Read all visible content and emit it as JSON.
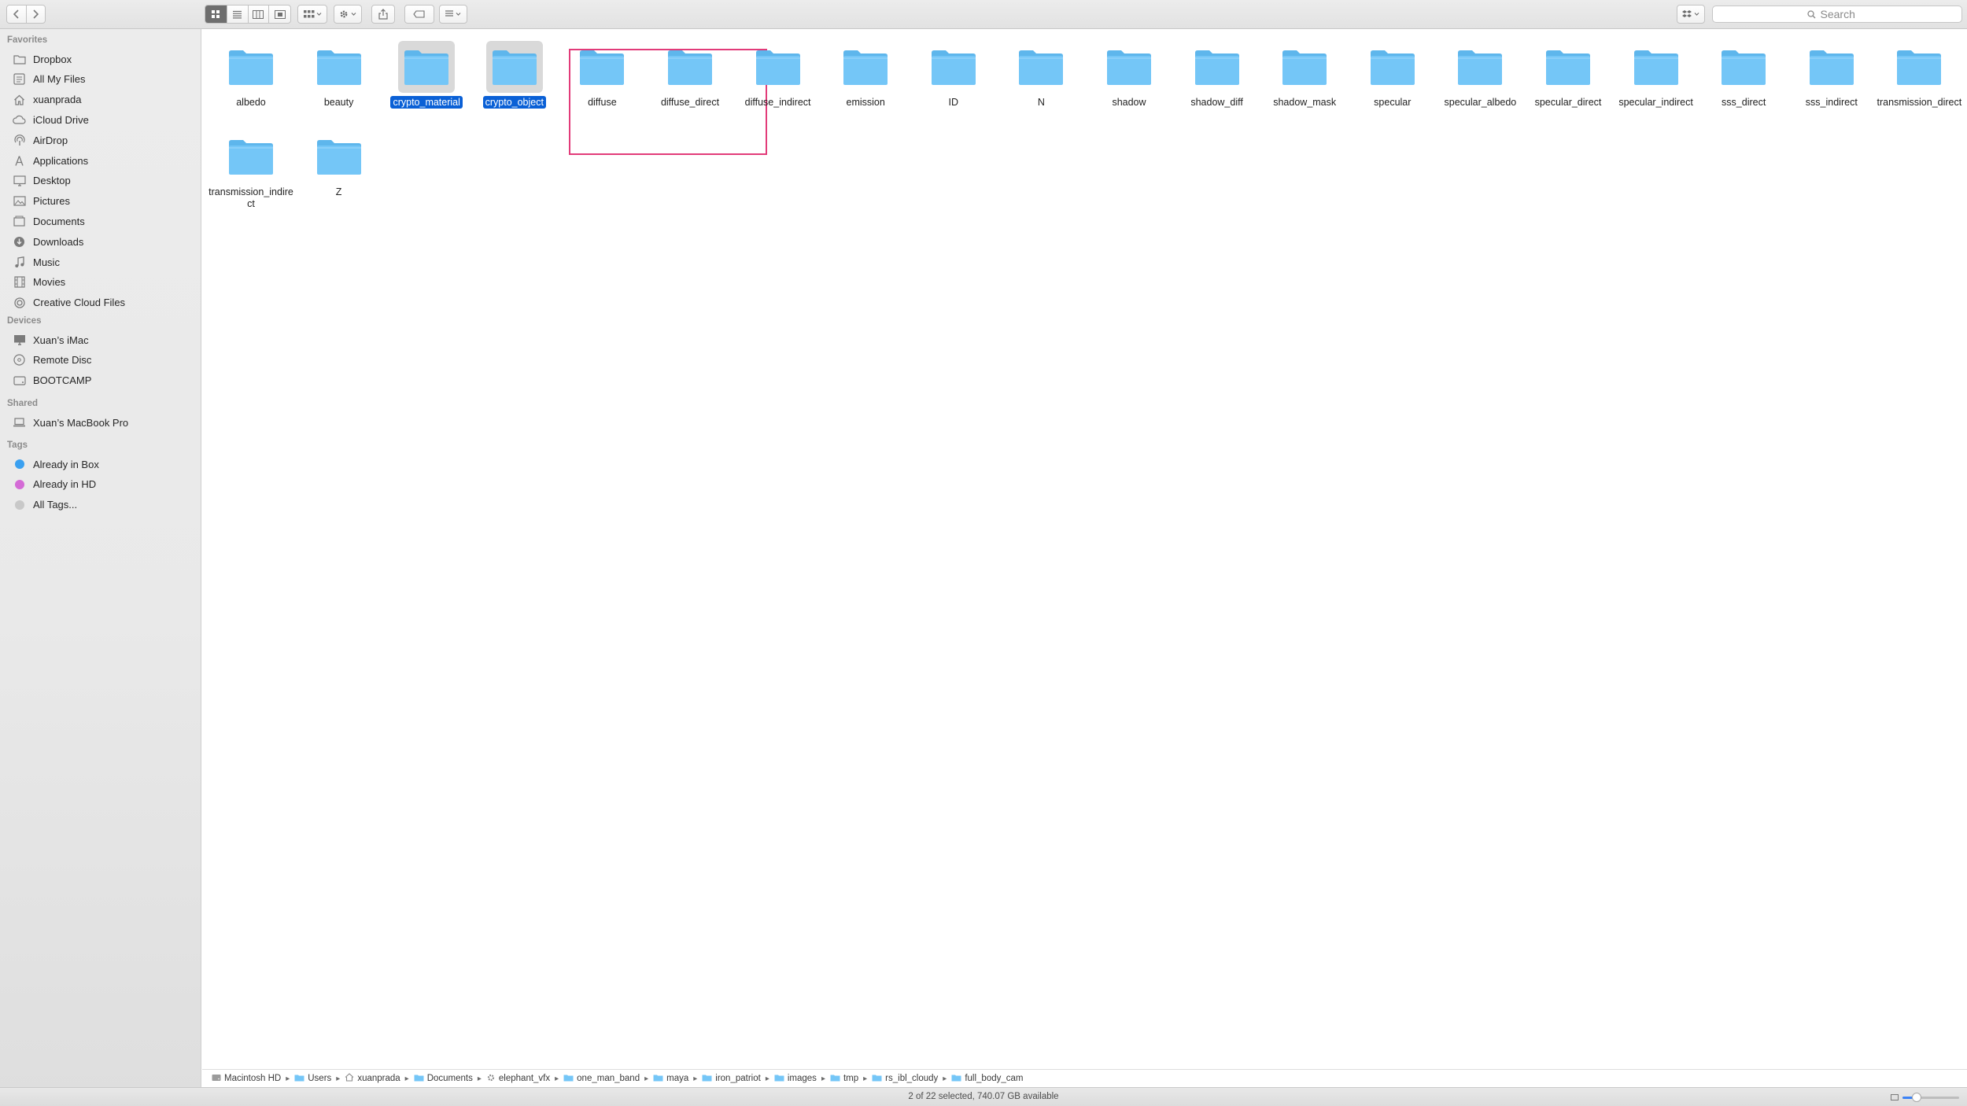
{
  "toolbar": {
    "search_placeholder": "Search"
  },
  "sidebar": {
    "sections": [
      {
        "heading": "Favorites",
        "items": [
          {
            "label": "Dropbox",
            "icon": "folder-icon"
          },
          {
            "label": "All My Files",
            "icon": "all-files-icon"
          },
          {
            "label": "xuanprada",
            "icon": "home-icon"
          },
          {
            "label": "iCloud Drive",
            "icon": "cloud-icon"
          },
          {
            "label": "AirDrop",
            "icon": "airdrop-icon"
          },
          {
            "label": "Applications",
            "icon": "applications-icon"
          },
          {
            "label": "Desktop",
            "icon": "desktop-icon"
          },
          {
            "label": "Pictures",
            "icon": "pictures-icon"
          },
          {
            "label": "Documents",
            "icon": "documents-icon"
          },
          {
            "label": "Downloads",
            "icon": "downloads-icon"
          },
          {
            "label": "Music",
            "icon": "music-icon"
          },
          {
            "label": "Movies",
            "icon": "movies-icon"
          },
          {
            "label": "Creative Cloud Files",
            "icon": "creative-cloud-icon"
          }
        ]
      },
      {
        "heading": "Devices",
        "items": [
          {
            "label": "Xuan’s iMac",
            "icon": "imac-icon"
          },
          {
            "label": "Remote Disc",
            "icon": "disc-icon"
          },
          {
            "label": "BOOTCAMP",
            "icon": "drive-icon"
          }
        ]
      },
      {
        "heading": "Shared",
        "items": [
          {
            "label": "Xuan’s MacBook Pro",
            "icon": "laptop-icon"
          }
        ]
      },
      {
        "heading": "Tags",
        "items": [
          {
            "label": "Already in Box",
            "icon": "tag-dot-icon",
            "color": "#3aa0f0"
          },
          {
            "label": "Already in HD",
            "icon": "tag-dot-icon",
            "color": "#d46bd6"
          },
          {
            "label": "All Tags...",
            "icon": "tag-dot-icon",
            "color": "#c8c8c8"
          }
        ]
      }
    ]
  },
  "folders": [
    {
      "name": "albedo",
      "selected": false
    },
    {
      "name": "beauty",
      "selected": false
    },
    {
      "name": "crypto_material",
      "selected": true
    },
    {
      "name": "crypto_object",
      "selected": true
    },
    {
      "name": "diffuse",
      "selected": false
    },
    {
      "name": "diffuse_direct",
      "selected": false
    },
    {
      "name": "diffuse_indirect",
      "selected": false
    },
    {
      "name": "emission",
      "selected": false
    },
    {
      "name": "ID",
      "selected": false
    },
    {
      "name": "N",
      "selected": false
    },
    {
      "name": "shadow",
      "selected": false
    },
    {
      "name": "shadow_diff",
      "selected": false
    },
    {
      "name": "shadow_mask",
      "selected": false
    },
    {
      "name": "specular",
      "selected": false
    },
    {
      "name": "specular_albedo",
      "selected": false
    },
    {
      "name": "specular_direct",
      "selected": false
    },
    {
      "name": "specular_indirect",
      "selected": false
    },
    {
      "name": "sss_direct",
      "selected": false
    },
    {
      "name": "sss_indirect",
      "selected": false
    },
    {
      "name": "transmission_direct",
      "selected": false
    },
    {
      "name": "transmission_indirect",
      "selected": false
    },
    {
      "name": "Z",
      "selected": false
    }
  ],
  "path": [
    {
      "label": "Macintosh HD",
      "icon": "hard-drive-icon"
    },
    {
      "label": "Users",
      "icon": "folder-icon"
    },
    {
      "label": "xuanprada",
      "icon": "home-icon"
    },
    {
      "label": "Documents",
      "icon": "folder-icon"
    },
    {
      "label": "elephant_vfx",
      "icon": "gear-folder-icon"
    },
    {
      "label": "one_man_band",
      "icon": "folder-icon"
    },
    {
      "label": "maya",
      "icon": "folder-icon"
    },
    {
      "label": "iron_patriot",
      "icon": "folder-icon"
    },
    {
      "label": "images",
      "icon": "folder-icon"
    },
    {
      "label": "tmp",
      "icon": "folder-icon"
    },
    {
      "label": "rs_ibl_cloudy",
      "icon": "folder-icon"
    },
    {
      "label": "full_body_cam",
      "icon": "folder-icon"
    }
  ],
  "status": {
    "text": "2 of 22 selected, 740.07 GB available",
    "zoom_fraction": 0.25
  },
  "colors": {
    "folder": "#74c6f7",
    "folder_dark": "#5eb6ec",
    "selection": "#0a60d6",
    "highlight_box": "#e23b79"
  }
}
